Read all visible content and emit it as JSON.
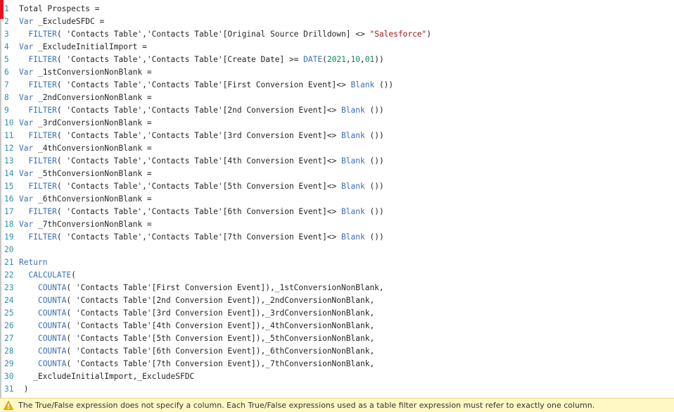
{
  "editor": {
    "lines": [
      {
        "n": "1",
        "parts": [
          [
            "t",
            "Total Prospects ="
          ]
        ]
      },
      {
        "n": "2",
        "parts": [
          [
            "k",
            "Var"
          ],
          [
            "t",
            " _ExcludeSFDC ="
          ]
        ]
      },
      {
        "n": "3",
        "parts": [
          [
            "t",
            "  "
          ],
          [
            "f",
            "FILTER"
          ],
          [
            "t",
            "( 'Contacts Table','Contacts Table'[Original Source Drilldown] <> "
          ],
          [
            "s",
            "\"Salesforce\""
          ],
          [
            "t",
            ")"
          ]
        ]
      },
      {
        "n": "4",
        "parts": [
          [
            "k",
            "Var"
          ],
          [
            "t",
            " _ExcludeInitialImport ="
          ]
        ]
      },
      {
        "n": "5",
        "parts": [
          [
            "t",
            "  "
          ],
          [
            "f",
            "FILTER"
          ],
          [
            "t",
            "( 'Contacts Table','Contacts Table'[Create Date] >= "
          ],
          [
            "f",
            "DATE"
          ],
          [
            "t",
            "("
          ],
          [
            "n",
            "2021"
          ],
          [
            "t",
            ","
          ],
          [
            "n",
            "10"
          ],
          [
            "t",
            ","
          ],
          [
            "n",
            "01"
          ],
          [
            "t",
            "))"
          ]
        ]
      },
      {
        "n": "6",
        "parts": [
          [
            "k",
            "Var"
          ],
          [
            "t",
            " _1stConversionNonBlank ="
          ]
        ]
      },
      {
        "n": "7",
        "parts": [
          [
            "t",
            "  "
          ],
          [
            "f",
            "FILTER"
          ],
          [
            "t",
            "( 'Contacts Table','Contacts Table'[First Conversion Event]<> "
          ],
          [
            "f",
            "Blank"
          ],
          [
            "t",
            " ())"
          ]
        ]
      },
      {
        "n": "8",
        "parts": [
          [
            "k",
            "Var"
          ],
          [
            "t",
            " _2ndConversionNonBlank ="
          ]
        ]
      },
      {
        "n": "9",
        "parts": [
          [
            "t",
            "  "
          ],
          [
            "f",
            "FILTER"
          ],
          [
            "t",
            "( 'Contacts Table','Contacts Table'[2nd Conversion Event]<> "
          ],
          [
            "f",
            "Blank"
          ],
          [
            "t",
            " ())"
          ]
        ]
      },
      {
        "n": "10",
        "parts": [
          [
            "k",
            "Var"
          ],
          [
            "t",
            " _3rdConversionNonBlank ="
          ]
        ]
      },
      {
        "n": "11",
        "parts": [
          [
            "t",
            "  "
          ],
          [
            "f",
            "FILTER"
          ],
          [
            "t",
            "( 'Contacts Table','Contacts Table'[3rd Conversion Event]<> "
          ],
          [
            "f",
            "Blank"
          ],
          [
            "t",
            " ())"
          ]
        ]
      },
      {
        "n": "12",
        "parts": [
          [
            "k",
            "Var"
          ],
          [
            "t",
            " _4thConversionNonBlank ="
          ]
        ]
      },
      {
        "n": "13",
        "parts": [
          [
            "t",
            "  "
          ],
          [
            "f",
            "FILTER"
          ],
          [
            "t",
            "( 'Contacts Table','Contacts Table'[4th Conversion Event]<> "
          ],
          [
            "f",
            "Blank"
          ],
          [
            "t",
            " ())"
          ]
        ]
      },
      {
        "n": "14",
        "parts": [
          [
            "k",
            "Var"
          ],
          [
            "t",
            " _5thConversionNonBlank ="
          ]
        ]
      },
      {
        "n": "15",
        "parts": [
          [
            "t",
            "  "
          ],
          [
            "f",
            "FILTER"
          ],
          [
            "t",
            "( 'Contacts Table','Contacts Table'[5th Conversion Event]<> "
          ],
          [
            "f",
            "Blank"
          ],
          [
            "t",
            " ())"
          ]
        ]
      },
      {
        "n": "16",
        "parts": [
          [
            "k",
            "Var"
          ],
          [
            "t",
            " _6thConversionNonBlank ="
          ]
        ]
      },
      {
        "n": "17",
        "parts": [
          [
            "t",
            "  "
          ],
          [
            "f",
            "FILTER"
          ],
          [
            "t",
            "( 'Contacts Table','Contacts Table'[6th Conversion Event]<> "
          ],
          [
            "f",
            "Blank"
          ],
          [
            "t",
            " ())"
          ]
        ]
      },
      {
        "n": "18",
        "parts": [
          [
            "k",
            "Var"
          ],
          [
            "t",
            " _7thConversionNonBlank ="
          ]
        ]
      },
      {
        "n": "19",
        "parts": [
          [
            "t",
            "  "
          ],
          [
            "f",
            "FILTER"
          ],
          [
            "t",
            "( 'Contacts Table','Contacts Table'[7th Conversion Event]<> "
          ],
          [
            "f",
            "Blank"
          ],
          [
            "t",
            " ())"
          ]
        ]
      },
      {
        "n": "20",
        "parts": []
      },
      {
        "n": "21",
        "parts": [
          [
            "k",
            "Return"
          ]
        ]
      },
      {
        "n": "22",
        "parts": [
          [
            "t",
            "  "
          ],
          [
            "f",
            "CALCULATE"
          ],
          [
            "t",
            "("
          ]
        ]
      },
      {
        "n": "23",
        "parts": [
          [
            "t",
            "    "
          ],
          [
            "f",
            "COUNTA"
          ],
          [
            "t",
            "( 'Contacts Table'[First Conversion Event]),_1stConversionNonBlank,"
          ]
        ]
      },
      {
        "n": "24",
        "parts": [
          [
            "t",
            "    "
          ],
          [
            "f",
            "COUNTA"
          ],
          [
            "t",
            "( 'Contacts Table'[2nd Conversion Event]),_2ndConversionNonBlank,"
          ]
        ]
      },
      {
        "n": "25",
        "parts": [
          [
            "t",
            "    "
          ],
          [
            "f",
            "COUNTA"
          ],
          [
            "t",
            "( 'Contacts Table'[3rd Conversion Event]),_3rdConversionNonBlank,"
          ]
        ]
      },
      {
        "n": "26",
        "parts": [
          [
            "t",
            "    "
          ],
          [
            "f",
            "COUNTA"
          ],
          [
            "t",
            "( 'Contacts Table'[4th Conversion Event]),_4thConversionNonBlank,"
          ]
        ]
      },
      {
        "n": "27",
        "parts": [
          [
            "t",
            "    "
          ],
          [
            "f",
            "COUNTA"
          ],
          [
            "t",
            "( 'Contacts Table'[5th Conversion Event]),_5thConversionNonBlank,"
          ]
        ]
      },
      {
        "n": "28",
        "parts": [
          [
            "t",
            "    "
          ],
          [
            "f",
            "COUNTA"
          ],
          [
            "t",
            "( 'Contacts Table'[6th Conversion Event]),_6thConversionNonBlank,"
          ]
        ]
      },
      {
        "n": "29",
        "parts": [
          [
            "t",
            "    "
          ],
          [
            "f",
            "COUNTA"
          ],
          [
            "t",
            "( 'Contacts Table'[7th Conversion Event]),_7thConversionNonBlank,"
          ]
        ]
      },
      {
        "n": "30",
        "parts": [
          [
            "t",
            "   _ExcludeInitialImport,_ExcludeSFDC"
          ]
        ]
      },
      {
        "n": "31",
        "parts": [
          [
            "t",
            " )"
          ]
        ]
      }
    ]
  },
  "error": {
    "icon": "warning-icon",
    "message": "The True/False expression does not specify a column. Each True/False expressions used as a table filter expression must refer to exactly one column."
  },
  "colors": {
    "keyword": "#3b6fb6",
    "string": "#a31515",
    "number": "#098658",
    "line_number": "#2b91af",
    "error_bar": "#fff8c5",
    "error_marker": "#e81123"
  }
}
